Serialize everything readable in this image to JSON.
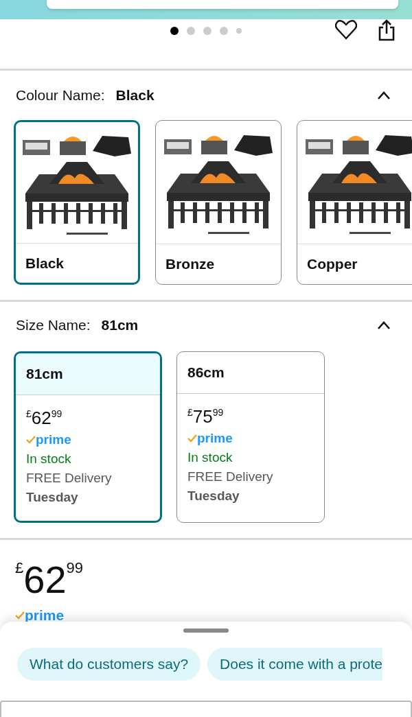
{
  "carousel_dots": [
    {
      "selected": true
    },
    {
      "selected": false
    },
    {
      "selected": false
    },
    {
      "selected": false
    },
    {
      "selected": false
    }
  ],
  "colour": {
    "label": "Colour Name:",
    "value": "Black",
    "expanded": true,
    "options": [
      {
        "name": "Black",
        "selected": true
      },
      {
        "name": "Bronze",
        "selected": false
      },
      {
        "name": "Copper",
        "selected": false
      }
    ]
  },
  "size": {
    "label": "Size Name:",
    "value": "81cm",
    "expanded": true,
    "options": [
      {
        "name": "81cm",
        "selected": true,
        "currency": "£",
        "whole": "62",
        "fraction": "99",
        "prime": "prime",
        "stock": "In stock",
        "delivery": "FREE Delivery",
        "day": "Tuesday"
      },
      {
        "name": "86cm",
        "selected": false,
        "currency": "£",
        "whole": "75",
        "fraction": "99",
        "prime": "prime",
        "stock": "In stock",
        "delivery": "FREE Delivery",
        "day": "Tuesday"
      }
    ]
  },
  "price": {
    "currency": "£",
    "whole": "62",
    "fraction": "99",
    "prime": "prime"
  },
  "suggestions": [
    "What do customers say?",
    "Does it come with a prote"
  ]
}
